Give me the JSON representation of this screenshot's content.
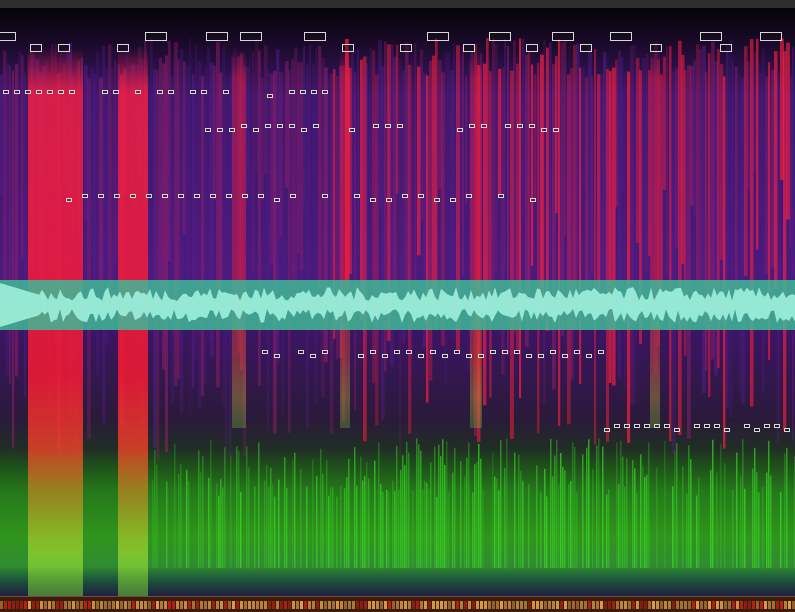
{
  "colors": {
    "background": "#120822",
    "purple": "#5a1f8f",
    "magenta": "#a0206a",
    "red": "#ff2040",
    "green": "#39e024",
    "yellow": "#e8d030",
    "waveform": "#5fd6b4",
    "marker": "#d8d8d8",
    "timeline": "#e0a040"
  },
  "icons": [
    "note-marker-icon"
  ],
  "marker_rows": [
    {
      "size": "lg",
      "count": 11
    },
    {
      "size": "md",
      "count": 10
    },
    {
      "size": "sm",
      "count": 30
    },
    {
      "size": "sm",
      "count": 30
    },
    {
      "size": "sm",
      "count": 30
    },
    {
      "size": "sm",
      "count": 30
    },
    {
      "size": "sm",
      "count": 20
    }
  ]
}
